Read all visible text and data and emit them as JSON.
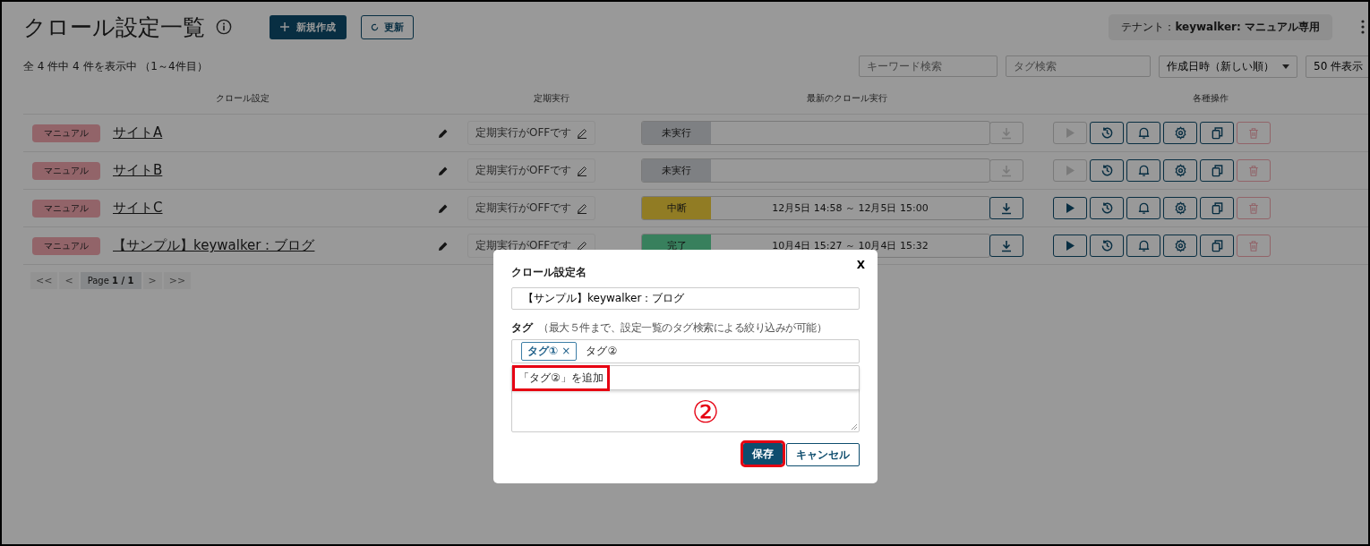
{
  "header": {
    "title": "クロール設定一覧",
    "new_button": "新規作成",
    "refresh_button": "更新",
    "tenant": "テナント：**keywalker: マニュアル専用**"
  },
  "summary": "全 4 件中 4 件を表示中 （1～4件目）",
  "filters": {
    "keyword_placeholder": "キーワード検索",
    "tag_placeholder": "タグ検索",
    "sort": "作成日時（新しい順）",
    "per_page": "50 件表示"
  },
  "columns": [
    "クロール設定",
    "定期実行",
    "最新のクロール実行",
    "各種操作"
  ],
  "rows": [
    {
      "tag": "マニュアル",
      "name": "サイトA",
      "schedule": "定期実行がOFFです",
      "status": {
        "label": "未実行",
        "kind": "not_run"
      },
      "runnable": false
    },
    {
      "tag": "マニュアル",
      "name": "サイトB",
      "schedule": "定期実行がOFFです",
      "status": {
        "label": "未実行",
        "kind": "not_run"
      },
      "runnable": false
    },
    {
      "tag": "マニュアル",
      "name": "サイトC",
      "schedule": "定期実行がOFFです",
      "status": {
        "label": "中断",
        "kind": "interrupted"
      },
      "period": "12月5日 14:58 ～ 12月5日 15:00",
      "runnable": true
    },
    {
      "tag": "マニュアル",
      "name": "【サンプル】keywalker：ブログ",
      "schedule": "定期実行がOFFです",
      "status": {
        "label": "完了",
        "kind": "done"
      },
      "period": "10月4日 15:27 ～ 10月4日 15:32",
      "runnable": true
    }
  ],
  "pagination": {
    "first": "<<",
    "prev": "<",
    "page": "Page **1 / 1**",
    "next": ">",
    "last": ">>"
  },
  "dialog": {
    "close": "X",
    "name_label": "クロール設定名",
    "name_value": "【サンプル】keywalker：ブログ",
    "tag_label": "タグ",
    "tag_hint": "（最大５件まで、設定一覧のタグ検索による絞り込みが可能）",
    "tags": [
      {
        "label": "タグ①",
        "remove": "×"
      }
    ],
    "tag_input": "タグ②",
    "suggestion": {
      "label": "「タグ②」を追加",
      "highlighted": true
    },
    "save": {
      "label": "保存",
      "highlighted": true
    },
    "cancel": {
      "label": "キャンセル",
      "highlighted": false
    },
    "step_marker": "②"
  }
}
